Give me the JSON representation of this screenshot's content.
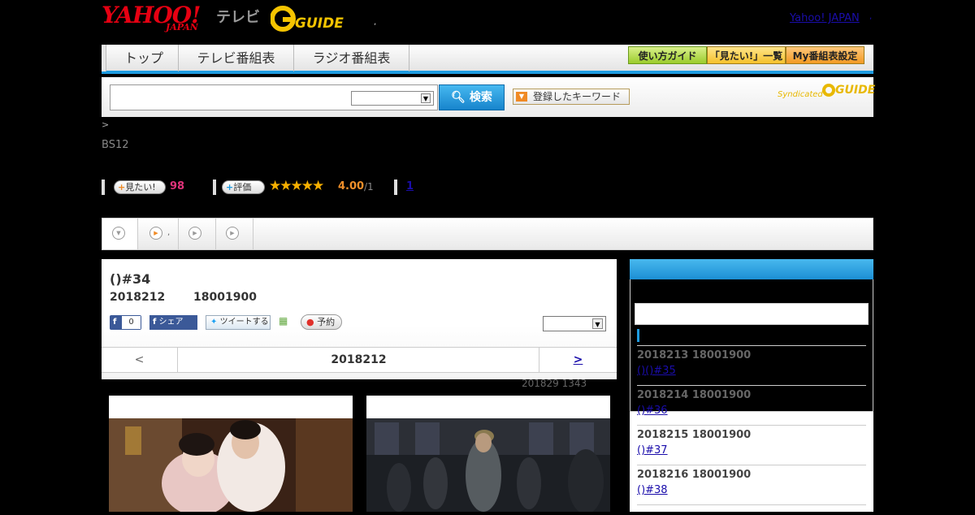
{
  "header": {
    "yahoo_logo": "YAHOO!",
    "japan_logo": "JAPAN",
    "tv_label": "テレビ",
    "gguide_logo": "GUIDE",
    "top_link": "Yahoo! JAPAN",
    "separator": ",",
    "separator2": ","
  },
  "nav": {
    "tabs": [
      "トップ",
      "テレビ番組表",
      "ラジオ番組表"
    ],
    "right_buttons": [
      "使い方ガイド",
      "「見たい!」一覧",
      "My番組表設定"
    ]
  },
  "search": {
    "button_label": "検索",
    "keyword_button": "登録したキーワード",
    "syndicated": "Syndicated",
    "syndicated_logo": "GUIDE"
  },
  "breadcrumb": ">",
  "station": "BS12",
  "stats": {
    "want_label": "見たい!",
    "want_count": "98",
    "rate_label": "評価",
    "stars": "★★★★★",
    "rating_value": "4.00",
    "rating_max": "/1",
    "review_count": "1"
  },
  "tabs_bar": {
    "tab2_label": ","
  },
  "program": {
    "title": "()#34",
    "date": "2018212",
    "time": "18001900",
    "fb_count": "0",
    "fb_share": "シェア",
    "tweet": "ツイートする",
    "reserve": "予約",
    "prev": "<",
    "nav_date": "2018212",
    "next": ">",
    "updated": "201829  1343"
  },
  "sidebar": {
    "episodes": [
      {
        "date": "2018213  18001900",
        "title": "()()#35"
      },
      {
        "date": "2018214  18001900",
        "title": "()#36"
      },
      {
        "date": "2018215  18001900",
        "title": "()#37"
      },
      {
        "date": "2018216  18001900",
        "title": "()#38"
      }
    ]
  },
  "colors": {
    "accent": "#1e9be0",
    "yahoo_red": "#e60012",
    "gguide_yellow": "#e8b800",
    "want_pink": "#e0337a"
  }
}
